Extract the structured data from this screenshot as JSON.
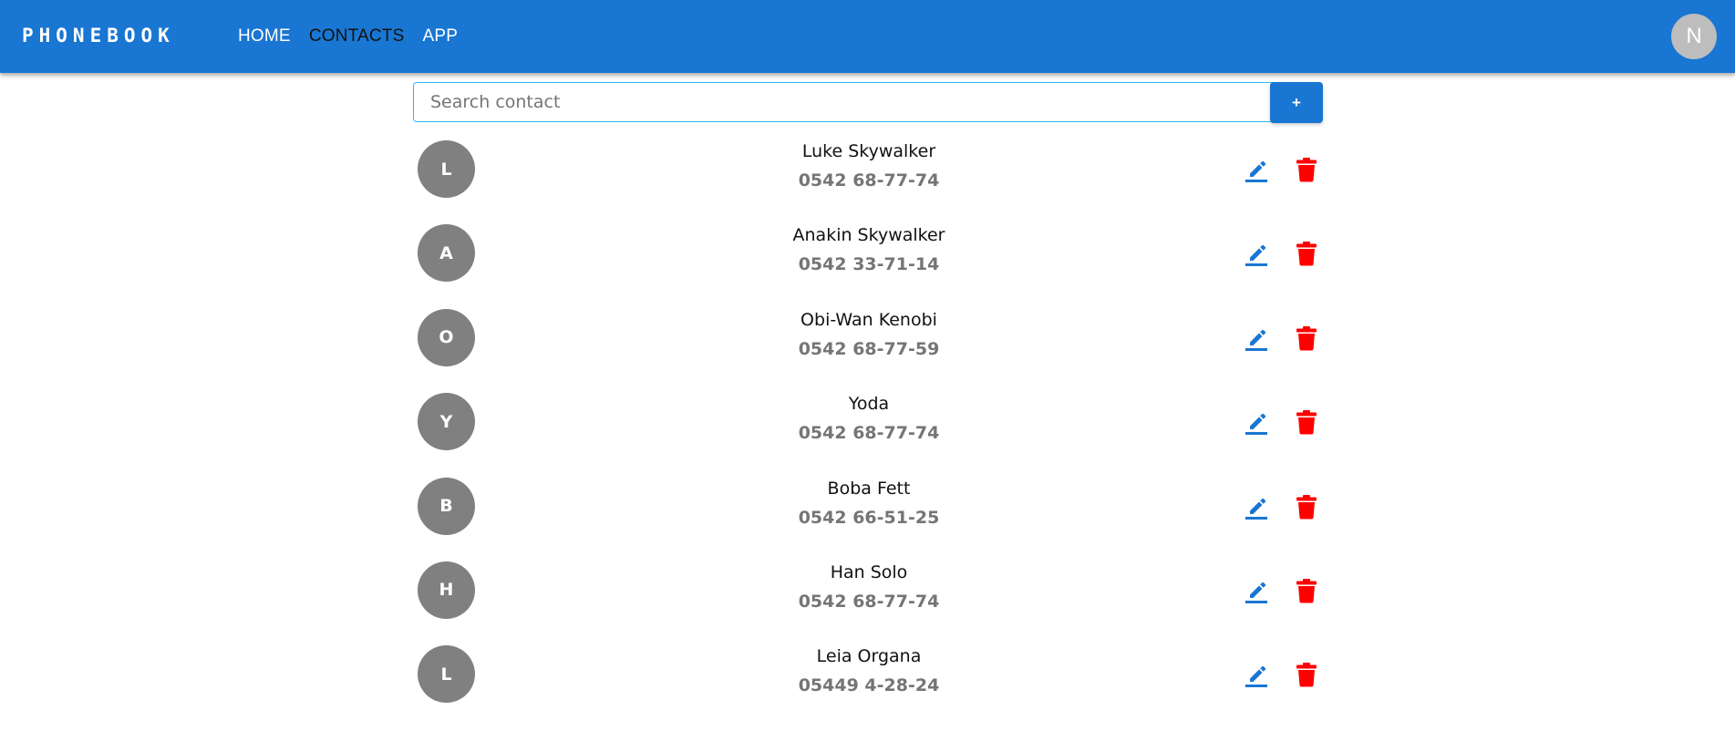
{
  "header": {
    "logo": "PHONEBOOK",
    "nav": [
      {
        "label": "HOME",
        "active": false
      },
      {
        "label": "CONTACTS",
        "active": true
      },
      {
        "label": "APP",
        "active": false
      }
    ],
    "user_initial": "N",
    "color": "#1976d2"
  },
  "search": {
    "placeholder": "Search contact",
    "value": "",
    "add_label": "+"
  },
  "contacts": [
    {
      "initial": "L",
      "name": "Luke Skywalker",
      "phone": "0542 68-77-74"
    },
    {
      "initial": "A",
      "name": "Anakin Skywalker",
      "phone": "0542 33-71-14"
    },
    {
      "initial": "O",
      "name": "Obi-Wan Kenobi",
      "phone": "0542 68-77-59"
    },
    {
      "initial": "Y",
      "name": "Yoda",
      "phone": "0542 68-77-74"
    },
    {
      "initial": "B",
      "name": "Boba Fett",
      "phone": "0542 66-51-25"
    },
    {
      "initial": "H",
      "name": "Han Solo",
      "phone": "0542 68-77-74"
    },
    {
      "initial": "L",
      "name": "Leia Organa",
      "phone": "05449 4-28-24"
    }
  ],
  "icons": {
    "edit": "pencil-icon",
    "delete": "trash-icon",
    "edit_color": "#1976d2",
    "delete_color": "#ff0000"
  }
}
